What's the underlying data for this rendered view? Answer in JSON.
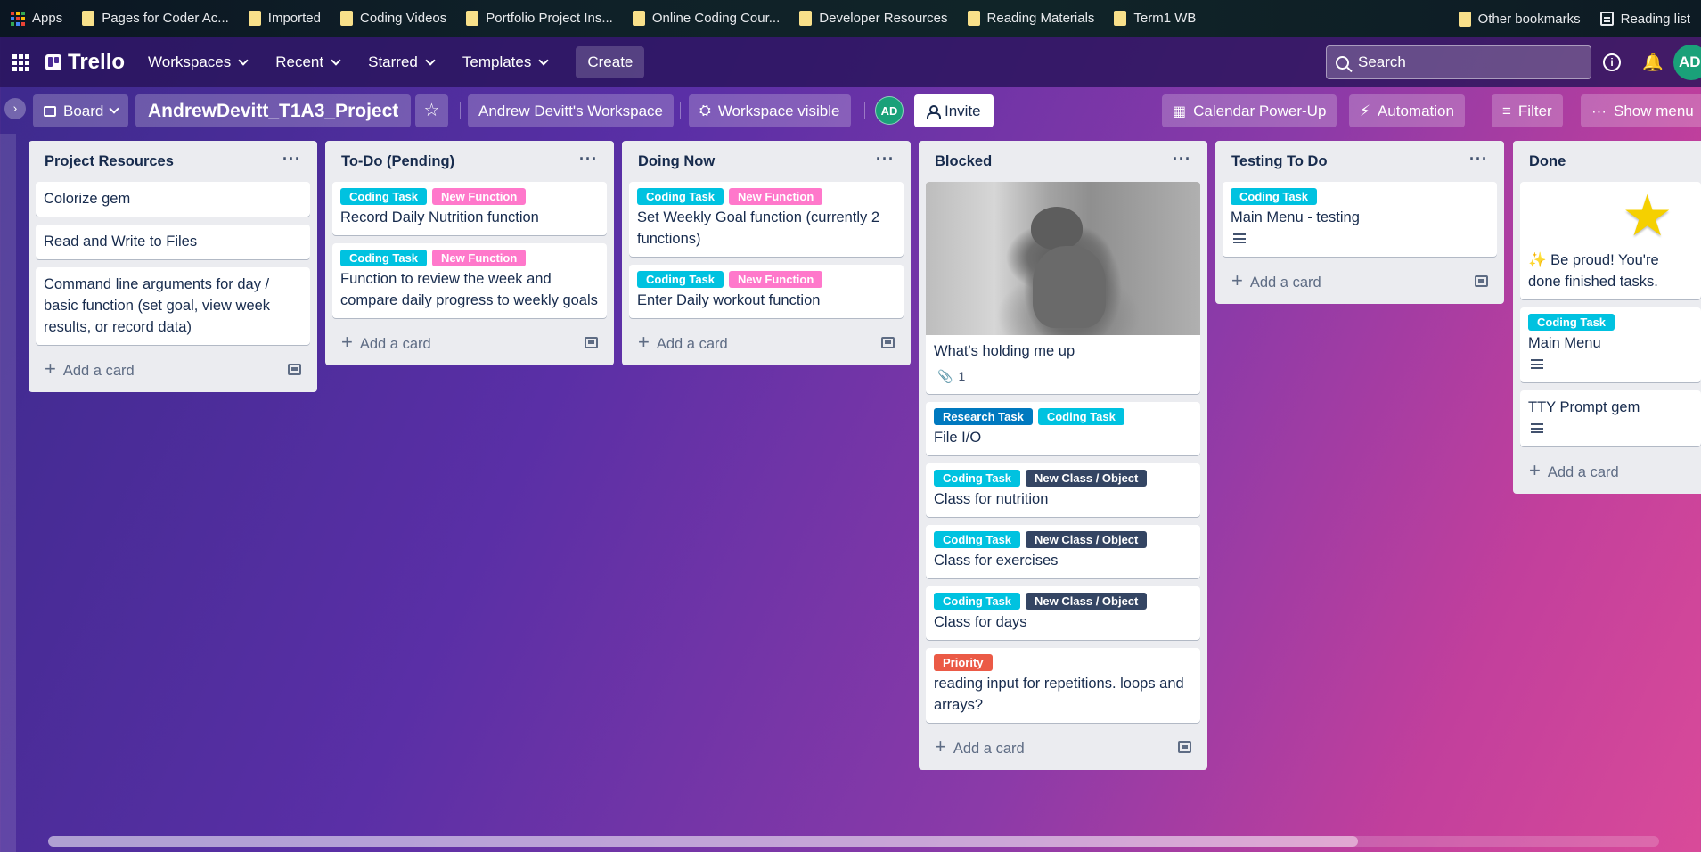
{
  "bookmarks": {
    "apps_label": "Apps",
    "items": [
      {
        "label": "Pages for Coder Ac..."
      },
      {
        "label": "Imported"
      },
      {
        "label": "Coding Videos"
      },
      {
        "label": "Portfolio Project Ins..."
      },
      {
        "label": "Online Coding Cour..."
      },
      {
        "label": "Developer Resources"
      },
      {
        "label": "Reading Materials"
      },
      {
        "label": "Term1 WB"
      }
    ],
    "other_label": "Other bookmarks",
    "reading_list_label": "Reading list"
  },
  "topnav": {
    "logo_text": "Trello",
    "workspaces": "Workspaces",
    "recent": "Recent",
    "starred": "Starred",
    "templates": "Templates",
    "create": "Create",
    "search_placeholder": "Search",
    "avatar": "AD"
  },
  "board": {
    "view_label": "Board",
    "title": "AndrewDevitt_T1A3_Project",
    "workspace": "Andrew Devitt's Workspace",
    "visibility": "Workspace visible",
    "member_avatar": "AD",
    "invite": "Invite",
    "calendar": "Calendar Power-Up",
    "automation": "Automation",
    "filter": "Filter",
    "show_menu": "Show menu",
    "add_card": "Add a card"
  },
  "label_colors": {
    "Coding Task": "#00c2e0",
    "New Function": "#ff78cb",
    "Research Task": "#0079bf",
    "New Class / Object": "#344563",
    "Priority": "#eb5a46"
  },
  "lists": [
    {
      "title": "Project Resources",
      "cards": [
        {
          "title": "Colorize gem"
        },
        {
          "title": "Read and Write to Files"
        },
        {
          "title": "Command line arguments for day / basic function (set goal, view week results, or record data)"
        }
      ]
    },
    {
      "title": "To-Do (Pending)",
      "cards": [
        {
          "labels": [
            "Coding Task",
            "New Function"
          ],
          "title": "Record Daily Nutrition function"
        },
        {
          "labels": [
            "Coding Task",
            "New Function"
          ],
          "title": "Function to review the week and compare daily progress to weekly goals"
        }
      ]
    },
    {
      "title": "Doing Now",
      "cards": [
        {
          "labels": [
            "Coding Task",
            "New Function"
          ],
          "title": "Set Weekly Goal function (currently 2 functions)"
        },
        {
          "labels": [
            "Coding Task",
            "New Function"
          ],
          "title": "Enter Daily workout function"
        }
      ]
    },
    {
      "title": "Blocked",
      "cards": [
        {
          "title": "What's holding me up",
          "attachments": "1",
          "has_cover": true
        },
        {
          "labels": [
            "Research Task",
            "Coding Task"
          ],
          "title": "File I/O"
        },
        {
          "labels": [
            "Coding Task",
            "New Class / Object"
          ],
          "title": "Class for nutrition"
        },
        {
          "labels": [
            "Coding Task",
            "New Class / Object"
          ],
          "title": "Class for exercises"
        },
        {
          "labels": [
            "Coding Task",
            "New Class / Object"
          ],
          "title": "Class for days"
        },
        {
          "labels": [
            "Priority"
          ],
          "title": "reading input for repetitions. loops and arrays?"
        }
      ]
    },
    {
      "title": "Testing To Do",
      "cards": [
        {
          "labels": [
            "Coding Task"
          ],
          "title": "Main Menu - testing",
          "has_description": true
        }
      ]
    },
    {
      "title": "Done",
      "cards": [
        {
          "title": "✨ Be proud! You're done finished tasks.",
          "has_star": true
        },
        {
          "labels": [
            "Coding Task"
          ],
          "title": "Main Menu",
          "has_description": true
        },
        {
          "title": "TTY Prompt gem",
          "has_description": true
        }
      ]
    }
  ]
}
